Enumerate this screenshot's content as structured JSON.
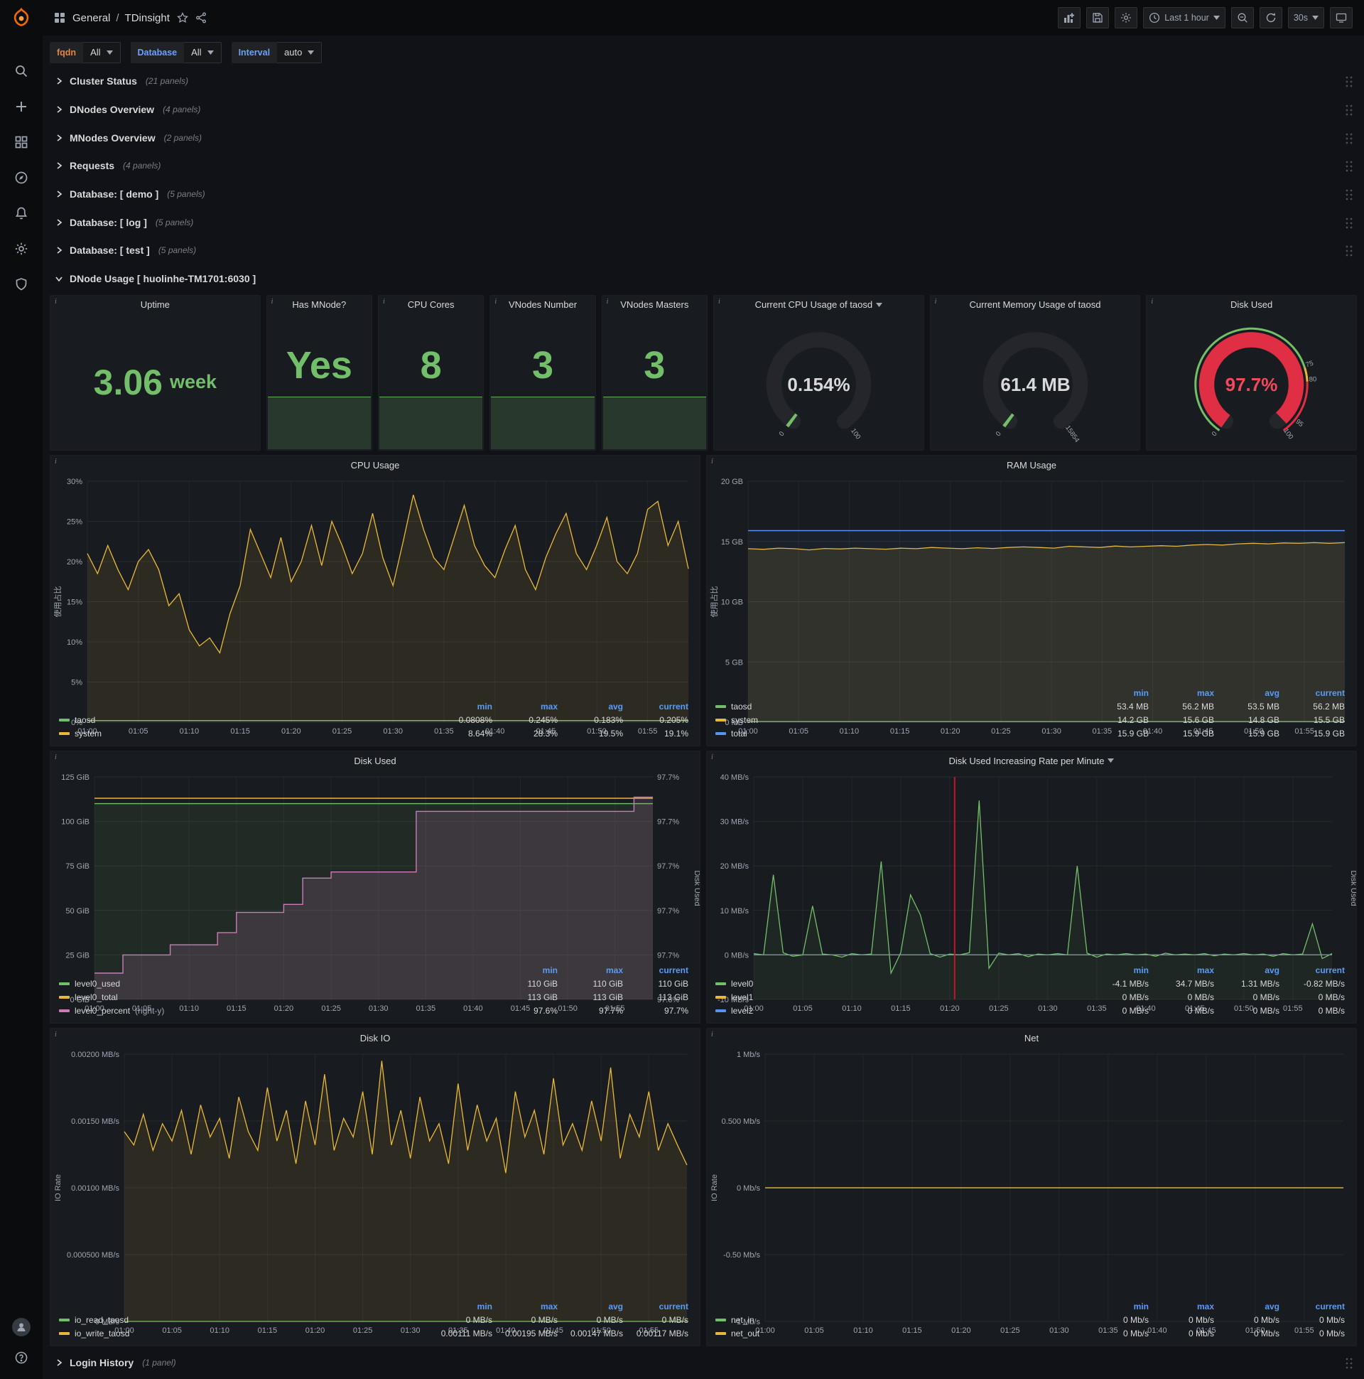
{
  "nav": {
    "section": "General",
    "separator": "/",
    "title": "TDinsight",
    "time_range": "Last 1 hour",
    "refresh_interval": "30s",
    "action_icons": [
      "add-panel",
      "save-dashboard",
      "dashboard-settings",
      "time-picker",
      "zoom-out",
      "refresh",
      "refresh-interval",
      "cycle-view"
    ]
  },
  "sidebar": {
    "items": [
      "search",
      "create",
      "dashboards",
      "explore",
      "alerting",
      "configuration",
      "server-admin"
    ],
    "bottom": [
      "user-profile",
      "help"
    ]
  },
  "variables": [
    {
      "label": "fqdn",
      "value": "All",
      "label_color": "#e9843f"
    },
    {
      "label": "Database",
      "value": "All",
      "label_color": "#6e9fff"
    },
    {
      "label": "Interval",
      "value": "auto",
      "label_color": "#6e9fff"
    }
  ],
  "rows": [
    {
      "title": "Cluster Status",
      "count": "(21 panels)"
    },
    {
      "title": "DNodes Overview",
      "count": "(4 panels)"
    },
    {
      "title": "MNodes Overview",
      "count": "(2 panels)"
    },
    {
      "title": "Requests",
      "count": "(4 panels)"
    },
    {
      "title": "Database: [ demo ]",
      "count": "(5 panels)"
    },
    {
      "title": "Database: [ log ]",
      "count": "(5 panels)"
    },
    {
      "title": "Database: [ test ]",
      "count": "(5 panels)"
    }
  ],
  "expanded_row": {
    "title": "DNode Usage [ huolinhe-TM1701:6030 ]"
  },
  "login_row": {
    "title": "Login History",
    "count": "(1 panel)"
  },
  "colors": {
    "green": "#73bf69",
    "yellow": "#eab839",
    "blue": "#5794f2",
    "pink": "#cf7ab8",
    "red": "#f2495c",
    "annotation_red": "#c4162a"
  },
  "stats": [
    {
      "title": "Uptime",
      "value": "3.06",
      "unit": "week",
      "sparkline": false
    },
    {
      "title": "Has MNode?",
      "value": "Yes",
      "sparkline": true
    },
    {
      "title": "CPU Cores",
      "value": "8",
      "sparkline": true
    },
    {
      "title": "VNodes Number",
      "value": "3",
      "sparkline": true
    },
    {
      "title": "VNodes Masters",
      "value": "3",
      "sparkline": true
    }
  ],
  "gauges": [
    {
      "title": "Current CPU Usage of taosd",
      "caret": true,
      "value": "0.154%",
      "fraction": 0.00154,
      "color": "#73bf69",
      "value_color": "#d8d9da",
      "min": "0",
      "max": "100"
    },
    {
      "title": "Current Memory Usage of taosd",
      "caret": false,
      "value": "61.4 MB",
      "fraction": 0.0038,
      "color": "#73bf69",
      "value_color": "#d8d9da",
      "min": "0",
      "max": "15854"
    },
    {
      "title": "Disk Used",
      "caret": false,
      "value": "97.7%",
      "fraction": 0.977,
      "color": "#e02f44",
      "value_color": "#f2495c",
      "min": "0",
      "max": "100",
      "thresholds": [
        {
          "label": "75",
          "frac": 0.75
        },
        {
          "label": "80",
          "frac": 0.8
        },
        {
          "label": "95",
          "frac": 0.95
        }
      ],
      "bands": [
        {
          "from": 0,
          "to": 0.75,
          "color": "#73bf69"
        },
        {
          "from": 0.75,
          "to": 0.8,
          "color": "#eab839"
        },
        {
          "from": 0.8,
          "to": 1,
          "color": "#e02f44"
        }
      ]
    }
  ],
  "x_ticks": [
    {
      "v": 0,
      "label": "01:00"
    },
    {
      "v": 5,
      "label": "01:05"
    },
    {
      "v": 10,
      "label": "01:10"
    },
    {
      "v": 15,
      "label": "01:15"
    },
    {
      "v": 20,
      "label": "01:20"
    },
    {
      "v": 25,
      "label": "01:25"
    },
    {
      "v": 30,
      "label": "01:30"
    },
    {
      "v": 35,
      "label": "01:35"
    },
    {
      "v": 40,
      "label": "01:40"
    },
    {
      "v": 45,
      "label": "01:45"
    },
    {
      "v": 50,
      "label": "01:50"
    },
    {
      "v": 55,
      "label": "01:55"
    }
  ],
  "chart_data": [
    {
      "type": "line",
      "title": "CPU Usage",
      "y_label": "使用占比",
      "ml": 52,
      "mr": 16,
      "x_range": [
        0,
        59
      ],
      "y_range": [
        0,
        30
      ],
      "y_ticks": [
        {
          "v": 0,
          "label": "0%"
        },
        {
          "v": 5,
          "label": "5%"
        },
        {
          "v": 10,
          "label": "10%"
        },
        {
          "v": 15,
          "label": "15%"
        },
        {
          "v": 20,
          "label": "20%"
        },
        {
          "v": 25,
          "label": "25%"
        },
        {
          "v": 30,
          "label": "30%"
        }
      ],
      "legend_columns": [
        "min",
        "max",
        "avg",
        "current"
      ],
      "series": [
        {
          "name": "taosd",
          "color": "#73bf69",
          "width": 1.3,
          "values": [
            0.2,
            0.2
          ],
          "stats": [
            "0.0808%",
            "0.245%",
            "0.183%",
            "0.205%"
          ]
        },
        {
          "name": "system",
          "color": "#eab839",
          "width": 1.3,
          "fill": 0.1,
          "values": [
            21,
            18.5,
            22,
            19,
            16.5,
            20,
            21.5,
            19,
            14.5,
            16,
            11.5,
            9.5,
            10.5,
            8.64,
            13.5,
            17,
            24,
            21,
            18,
            23,
            17.5,
            20,
            24.5,
            19.5,
            25,
            22,
            18.5,
            21,
            26,
            20.5,
            17,
            22.5,
            28.3,
            24,
            20.5,
            19,
            23,
            27,
            22,
            19.5,
            18,
            21.5,
            24.5,
            19,
            16.5,
            20.5,
            23.5,
            26,
            21,
            19,
            22,
            25.5,
            20,
            18.5,
            21,
            26.5,
            27.5,
            22,
            25,
            19.1
          ],
          "stats": [
            "8.64%",
            "28.3%",
            "19.5%",
            "19.1%"
          ]
        }
      ]
    },
    {
      "type": "line",
      "title": "RAM Usage",
      "y_label": "使用占比",
      "ml": 58,
      "mr": 16,
      "x_range": [
        0,
        59
      ],
      "y_range": [
        0,
        20
      ],
      "y_ticks": [
        {
          "v": 0,
          "label": "0 MB"
        },
        {
          "v": 5,
          "label": "5 GB"
        },
        {
          "v": 10,
          "label": "10 GB"
        },
        {
          "v": 15,
          "label": "15 GB"
        },
        {
          "v": 20,
          "label": "20 GB"
        }
      ],
      "legend_columns": [
        "min",
        "max",
        "avg",
        "current"
      ],
      "series": [
        {
          "name": "taosd",
          "color": "#73bf69",
          "width": 1.3,
          "values": [
            0.05,
            0.05
          ],
          "stats": [
            "53.4 MB",
            "56.2 MB",
            "53.5 MB",
            "56.2 MB"
          ]
        },
        {
          "name": "system",
          "color": "#eab839",
          "width": 1.3,
          "fill": 0.12,
          "values": [
            14.4,
            14.35,
            14.45,
            14.4,
            14.3,
            14.42,
            14.38,
            14.45,
            14.4,
            14.36,
            14.44,
            14.4,
            14.5,
            14.45,
            14.4,
            14.48,
            14.42,
            14.5,
            14.55,
            14.5,
            14.45,
            14.6,
            14.55,
            14.5,
            14.62,
            14.55,
            14.6,
            14.65,
            14.6,
            14.7,
            14.75,
            14.7,
            14.8,
            14.85,
            14.8,
            14.88,
            14.85,
            14.9,
            14.85,
            14.9
          ],
          "stats": [
            "14.2 GB",
            "15.6 GB",
            "14.8 GB",
            "15.5 GB"
          ]
        },
        {
          "name": "total",
          "color": "#5794f2",
          "width": 1.4,
          "fill": 0.05,
          "values": [
            15.9,
            15.9
          ],
          "stats": [
            "15.9 GB",
            "15.9 GB",
            "15.9 GB",
            "15.9 GB"
          ]
        }
      ]
    },
    {
      "type": "line",
      "title": "Disk Used",
      "ml": 62,
      "mr": 66,
      "right_label": "Disk Used",
      "x_range": [
        0,
        59
      ],
      "y_range": [
        0,
        125
      ],
      "y_ticks": [
        {
          "v": 0,
          "label": "0 GiB"
        },
        {
          "v": 25,
          "label": "25 GiB"
        },
        {
          "v": 50,
          "label": "50 GiB"
        },
        {
          "v": 75,
          "label": "75 GiB"
        },
        {
          "v": 100,
          "label": "100 GiB"
        },
        {
          "v": 125,
          "label": "125 GiB"
        }
      ],
      "right_range": [
        97.595,
        97.705
      ],
      "right_ticks": [
        "97.6%",
        "97.7%",
        "97.7%",
        "97.7%",
        "97.7%",
        "97.7%"
      ],
      "legend_columns": [
        "min",
        "max",
        "current"
      ],
      "series": [
        {
          "name": "level0_used",
          "color": "#73bf69",
          "width": 1.4,
          "fill": 0.1,
          "values": [
            110,
            110
          ],
          "stats": [
            "110 GiB",
            "110 GiB",
            "110 GiB"
          ]
        },
        {
          "name": "level0_total",
          "color": "#eab839",
          "width": 1.4,
          "values": [
            113,
            113
          ],
          "stats": [
            "113 GiB",
            "113 GiB",
            "113 GiB"
          ]
        },
        {
          "name": "level0_percent",
          "note": "(right-y)",
          "color": "#cf7ab8",
          "width": 1.4,
          "fill": 0.16,
          "axis": "right",
          "step": true,
          "values": [
            97.608,
            97.608,
            97.608,
            97.617,
            97.617,
            97.617,
            97.617,
            97.617,
            97.622,
            97.622,
            97.622,
            97.622,
            97.622,
            97.628,
            97.628,
            97.638,
            97.638,
            97.638,
            97.638,
            97.638,
            97.642,
            97.642,
            97.655,
            97.655,
            97.655,
            97.658,
            97.658,
            97.658,
            97.658,
            97.658,
            97.658,
            97.658,
            97.658,
            97.658,
            97.688,
            97.688,
            97.688,
            97.688,
            97.688,
            97.688,
            97.688,
            97.688,
            97.688,
            97.688,
            97.688,
            97.688,
            97.688,
            97.688,
            97.688,
            97.688,
            97.688,
            97.688,
            97.688,
            97.688,
            97.688,
            97.688,
            97.688,
            97.695,
            97.695,
            97.695
          ],
          "stats": [
            "97.6%",
            "97.7%",
            "97.7%"
          ]
        }
      ]
    },
    {
      "type": "line",
      "title": "Disk Used Increasing Rate per Minute",
      "caret": true,
      "ml": 66,
      "mr": 34,
      "right_label": "Disk Used",
      "x_range": [
        0,
        59
      ],
      "y_range": [
        -10,
        40
      ],
      "y_ticks": [
        {
          "v": -10,
          "label": "-10 MB/s"
        },
        {
          "v": 0,
          "label": "0 MB/s"
        },
        {
          "v": 10,
          "label": "10 MB/s"
        },
        {
          "v": 20,
          "label": "20 MB/s"
        },
        {
          "v": 30,
          "label": "30 MB/s"
        },
        {
          "v": 40,
          "label": "40 MB/s"
        }
      ],
      "annotation": {
        "x": 20.5,
        "color": "#c4162a"
      },
      "legend_columns": [
        "min",
        "max",
        "avg",
        "current"
      ],
      "series": [
        {
          "name": "level0",
          "color": "#73bf69",
          "width": 1.3,
          "fill": 0.08,
          "values": [
            0.3,
            0,
            18,
            0.5,
            -0.3,
            0,
            11,
            0.2,
            0,
            -0.5,
            0.3,
            0,
            0.2,
            21,
            -4.1,
            0.5,
            13.5,
            9,
            0.3,
            -0.5,
            0.2,
            0,
            0.5,
            34.7,
            -3,
            0.4,
            0,
            0.3,
            -0.4,
            0.2,
            0,
            0.3,
            0,
            20,
            0.4,
            -0.5,
            0.2,
            0,
            0.3,
            0,
            0.2,
            -0.3,
            0.4,
            0,
            0.2,
            0,
            0.3,
            -0.2,
            0.2,
            0,
            0.3,
            0,
            0.2,
            -0.3,
            0.3,
            0,
            0.2,
            7,
            -0.82,
            0.3
          ],
          "stats": [
            "-4.1 MB/s",
            "34.7 MB/s",
            "1.31 MB/s",
            "-0.82 MB/s"
          ]
        },
        {
          "name": "level1",
          "color": "#eab839",
          "width": 1.3,
          "values": [
            0,
            0
          ],
          "stats": [
            "0 MB/s",
            "0 MB/s",
            "0 MB/s",
            "0 MB/s"
          ]
        },
        {
          "name": "level2",
          "color": "#5794f2",
          "width": 1.3,
          "values": [
            0,
            0
          ],
          "stats": [
            "0 MB/s",
            "0 MB/s",
            "0 MB/s",
            "0 MB/s"
          ]
        }
      ]
    },
    {
      "type": "line",
      "title": "Disk IO",
      "y_label": "IO Rate",
      "ml": 104,
      "mr": 18,
      "x_range": [
        0,
        59
      ],
      "y_range": [
        0,
        0.002
      ],
      "y_ticks": [
        {
          "v": 0,
          "label": "0 MB/s"
        },
        {
          "v": 0.0005,
          "label": "0.000500 MB/s"
        },
        {
          "v": 0.001,
          "label": "0.00100 MB/s"
        },
        {
          "v": 0.0015,
          "label": "0.00150 MB/s"
        },
        {
          "v": 0.002,
          "label": "0.00200 MB/s"
        }
      ],
      "legend_columns": [
        "min",
        "max",
        "avg",
        "current"
      ],
      "series": [
        {
          "name": "io_read_taosd",
          "color": "#73bf69",
          "width": 1.3,
          "values": [
            0,
            0
          ],
          "stats": [
            "0 MB/s",
            "0 MB/s",
            "0 MB/s",
            "0 MB/s"
          ]
        },
        {
          "name": "io_write_taosd",
          "color": "#eab839",
          "width": 1.3,
          "fill": 0.1,
          "values": [
            0.00142,
            0.00132,
            0.00155,
            0.00128,
            0.00148,
            0.00135,
            0.00158,
            0.00125,
            0.00162,
            0.00138,
            0.00152,
            0.00122,
            0.00168,
            0.00142,
            0.00128,
            0.00175,
            0.00135,
            0.00158,
            0.00118,
            0.00165,
            0.00132,
            0.00185,
            0.00128,
            0.00152,
            0.00138,
            0.00172,
            0.00125,
            0.00195,
            0.00132,
            0.00158,
            0.00122,
            0.00168,
            0.00135,
            0.00148,
            0.00118,
            0.00178,
            0.00128,
            0.00162,
            0.00135,
            0.00152,
            0.00111,
            0.00172,
            0.00138,
            0.00158,
            0.00125,
            0.00182,
            0.00132,
            0.00148,
            0.00128,
            0.00165,
            0.00135,
            0.0019,
            0.00122,
            0.00155,
            0.00138,
            0.00172,
            0.00128,
            0.00148,
            0.00132,
            0.00117
          ],
          "stats": [
            "0.00111 MB/s",
            "0.00195 MB/s",
            "0.00147 MB/s",
            "0.00117 MB/s"
          ]
        }
      ]
    },
    {
      "type": "line",
      "title": "Net",
      "y_label": "IO Rate",
      "ml": 82,
      "mr": 18,
      "x_range": [
        0,
        59
      ],
      "y_range": [
        -1,
        1
      ],
      "y_ticks": [
        {
          "v": -1,
          "label": "-1 Mb/s"
        },
        {
          "v": -0.5,
          "label": "-0.50 Mb/s"
        },
        {
          "v": 0,
          "label": "0 Mb/s"
        },
        {
          "v": 0.5,
          "label": "0.500 Mb/s"
        },
        {
          "v": 1,
          "label": "1 Mb/s"
        }
      ],
      "legend_columns": [
        "min",
        "max",
        "avg",
        "current"
      ],
      "series": [
        {
          "name": "net_in",
          "color": "#73bf69",
          "width": 1.3,
          "values": [
            0,
            0
          ],
          "stats": [
            "0 Mb/s",
            "0 Mb/s",
            "0 Mb/s",
            "0 Mb/s"
          ]
        },
        {
          "name": "net_out",
          "color": "#eab839",
          "width": 1.3,
          "values": [
            0,
            0
          ],
          "stats": [
            "0 Mb/s",
            "0 Mb/s",
            "0 Mb/s",
            "0 Mb/s"
          ]
        }
      ]
    }
  ]
}
